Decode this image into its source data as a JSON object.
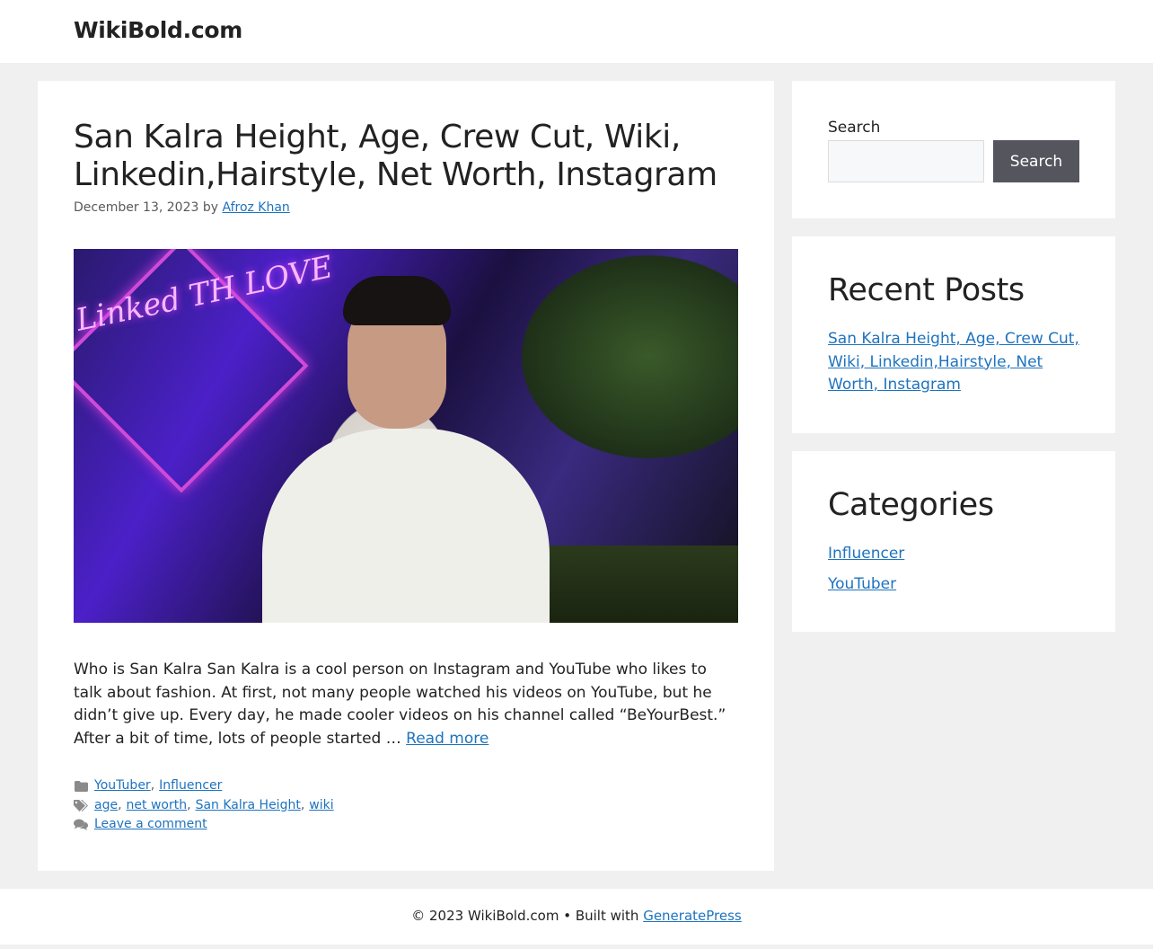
{
  "header": {
    "site_title": "WikiBold.com"
  },
  "article": {
    "title": "San Kalra Height, Age, Crew Cut, Wiki, Linkedin,Hairstyle, Net Worth, Instagram",
    "date": "December 13, 2023",
    "by": "by",
    "author": "Afroz Khan",
    "image": {
      "neon_sign_text": "Linked TH LOVE"
    },
    "summary": "Who is San Kalra San Kalra is a cool person on Instagram and YouTube who likes to talk about fashion. At first, not many people watched his videos on YouTube, but he didn’t give up. Every day, he made cooler videos on his channel called “BeYourBest.” After a bit of time, lots of people started …",
    "read_more": "Read more",
    "categories": [
      "YouTuber",
      "Influencer"
    ],
    "tags": [
      "age",
      "net worth",
      "San Kalra Height",
      "wiki"
    ],
    "comment_link": "Leave a comment",
    "icons": {
      "categories": "folder-icon",
      "tags": "tags-icon",
      "comments": "comments-icon"
    }
  },
  "sidebar": {
    "search": {
      "label": "Search",
      "input_value": "",
      "button_label": "Search"
    },
    "recent_posts": {
      "title": "Recent Posts",
      "items": [
        "San Kalra Height, Age, Crew Cut, Wiki, Linkedin,Hairstyle, Net Worth, Instagram"
      ]
    },
    "categories": {
      "title": "Categories",
      "items": [
        "Influencer",
        "YouTuber"
      ]
    }
  },
  "footer": {
    "copyright_text": "© 2023 WikiBold.com • Built with",
    "builder_link": "GeneratePress"
  },
  "colors": {
    "link": "#1e73be",
    "text": "#222222",
    "meta": "#595959",
    "page_bg": "#f0f0f0",
    "button_bg": "#55555e"
  }
}
